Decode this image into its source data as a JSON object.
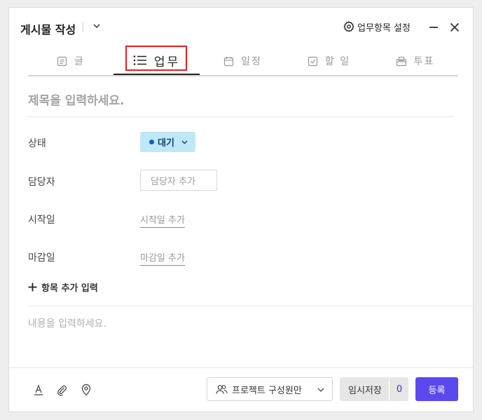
{
  "header": {
    "title": "게시물 작성",
    "settings_label": "업무항목 설정"
  },
  "tabs": [
    {
      "label": "글",
      "icon": "document-icon"
    },
    {
      "label": "업무",
      "icon": "list-icon",
      "active": true
    },
    {
      "label": "일정",
      "icon": "calendar-icon"
    },
    {
      "label": "할 일",
      "icon": "checkbox-icon"
    },
    {
      "label": "투표",
      "icon": "vote-box-icon"
    }
  ],
  "form": {
    "subject_placeholder": "제목을 입력하세요.",
    "status_label": "상태",
    "status_value": "대기",
    "assignee_label": "담당자",
    "assignee_placeholder": "담당자 추가",
    "start_label": "시작일",
    "start_placeholder": "시작일 추가",
    "due_label": "마감일",
    "due_placeholder": "마감일 추가",
    "add_item_label": "항목 추가 입력",
    "content_placeholder": "내용을 입력하세요."
  },
  "footer": {
    "scope_label": "프로젝트 구성원만",
    "draft_label": "임시저장",
    "draft_count": "0",
    "submit_label": "등록"
  },
  "colors": {
    "accent": "#5b49f0",
    "status_bg": "#bfe8f7",
    "status_dot": "#1160c0",
    "highlight_border": "#e02020"
  }
}
